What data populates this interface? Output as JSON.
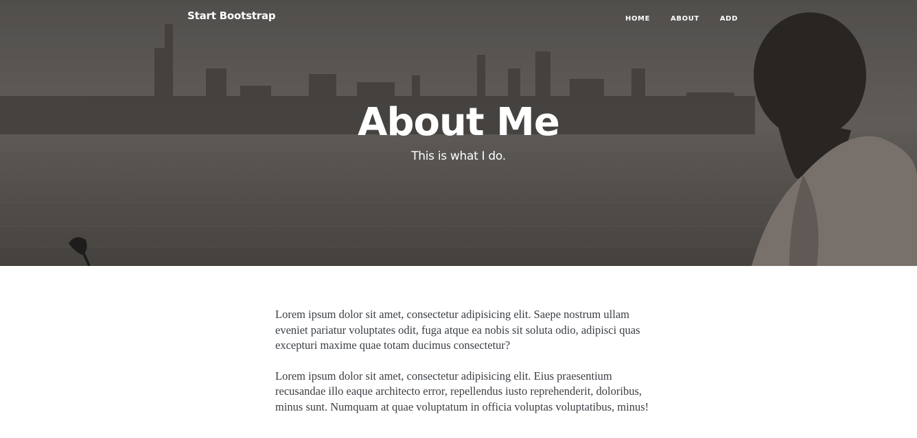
{
  "navbar": {
    "brand": "Start Bootstrap",
    "links": [
      "HOME",
      "ABOUT",
      "ADD"
    ]
  },
  "header": {
    "title": "About Me",
    "subheading": "This is what I do."
  },
  "content": {
    "paragraphs": [
      "Lorem ipsum dolor sit amet, consectetur adipisicing elit. Saepe nostrum ullam eveniet pariatur voluptates odit, fuga atque ea nobis sit soluta odio, adipisci quas excepturi maxime quae totam ducimus consectetur?",
      "Lorem ipsum dolor sit amet, consectetur adipisicing elit. Eius praesentium recusandae illo eaque architecto error, repellendus iusto reprehenderit, doloribus, minus sunt. Numquam at quae voluptatum in officia voluptas voluptatibus, minus!"
    ]
  },
  "colors": {
    "hero_overlay": "#5f5a56",
    "text_white": "#ffffff",
    "body_text": "#3a3f44"
  }
}
